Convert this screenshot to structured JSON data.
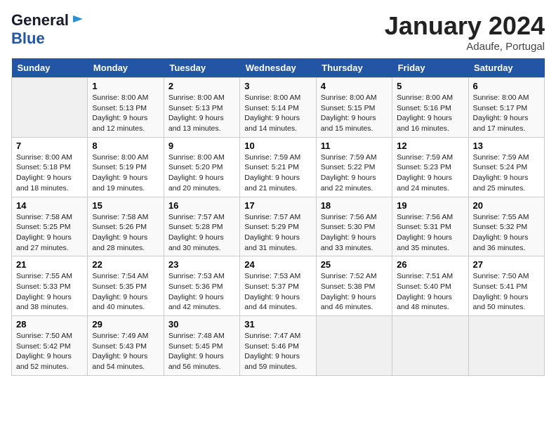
{
  "header": {
    "logo_line1": "General",
    "logo_line2": "Blue",
    "month": "January 2024",
    "location": "Adaufe, Portugal"
  },
  "days_of_week": [
    "Sunday",
    "Monday",
    "Tuesday",
    "Wednesday",
    "Thursday",
    "Friday",
    "Saturday"
  ],
  "weeks": [
    [
      {
        "day": "",
        "sunrise": "",
        "sunset": "",
        "daylight": ""
      },
      {
        "day": "1",
        "sunrise": "8:00 AM",
        "sunset": "5:13 PM",
        "daylight": "9 hours and 12 minutes."
      },
      {
        "day": "2",
        "sunrise": "8:00 AM",
        "sunset": "5:13 PM",
        "daylight": "9 hours and 13 minutes."
      },
      {
        "day": "3",
        "sunrise": "8:00 AM",
        "sunset": "5:14 PM",
        "daylight": "9 hours and 14 minutes."
      },
      {
        "day": "4",
        "sunrise": "8:00 AM",
        "sunset": "5:15 PM",
        "daylight": "9 hours and 15 minutes."
      },
      {
        "day": "5",
        "sunrise": "8:00 AM",
        "sunset": "5:16 PM",
        "daylight": "9 hours and 16 minutes."
      },
      {
        "day": "6",
        "sunrise": "8:00 AM",
        "sunset": "5:17 PM",
        "daylight": "9 hours and 17 minutes."
      }
    ],
    [
      {
        "day": "7",
        "sunrise": "8:00 AM",
        "sunset": "5:18 PM",
        "daylight": "9 hours and 18 minutes."
      },
      {
        "day": "8",
        "sunrise": "8:00 AM",
        "sunset": "5:19 PM",
        "daylight": "9 hours and 19 minutes."
      },
      {
        "day": "9",
        "sunrise": "8:00 AM",
        "sunset": "5:20 PM",
        "daylight": "9 hours and 20 minutes."
      },
      {
        "day": "10",
        "sunrise": "7:59 AM",
        "sunset": "5:21 PM",
        "daylight": "9 hours and 21 minutes."
      },
      {
        "day": "11",
        "sunrise": "7:59 AM",
        "sunset": "5:22 PM",
        "daylight": "9 hours and 22 minutes."
      },
      {
        "day": "12",
        "sunrise": "7:59 AM",
        "sunset": "5:23 PM",
        "daylight": "9 hours and 24 minutes."
      },
      {
        "day": "13",
        "sunrise": "7:59 AM",
        "sunset": "5:24 PM",
        "daylight": "9 hours and 25 minutes."
      }
    ],
    [
      {
        "day": "14",
        "sunrise": "7:58 AM",
        "sunset": "5:25 PM",
        "daylight": "9 hours and 27 minutes."
      },
      {
        "day": "15",
        "sunrise": "7:58 AM",
        "sunset": "5:26 PM",
        "daylight": "9 hours and 28 minutes."
      },
      {
        "day": "16",
        "sunrise": "7:57 AM",
        "sunset": "5:28 PM",
        "daylight": "9 hours and 30 minutes."
      },
      {
        "day": "17",
        "sunrise": "7:57 AM",
        "sunset": "5:29 PM",
        "daylight": "9 hours and 31 minutes."
      },
      {
        "day": "18",
        "sunrise": "7:56 AM",
        "sunset": "5:30 PM",
        "daylight": "9 hours and 33 minutes."
      },
      {
        "day": "19",
        "sunrise": "7:56 AM",
        "sunset": "5:31 PM",
        "daylight": "9 hours and 35 minutes."
      },
      {
        "day": "20",
        "sunrise": "7:55 AM",
        "sunset": "5:32 PM",
        "daylight": "9 hours and 36 minutes."
      }
    ],
    [
      {
        "day": "21",
        "sunrise": "7:55 AM",
        "sunset": "5:33 PM",
        "daylight": "9 hours and 38 minutes."
      },
      {
        "day": "22",
        "sunrise": "7:54 AM",
        "sunset": "5:35 PM",
        "daylight": "9 hours and 40 minutes."
      },
      {
        "day": "23",
        "sunrise": "7:53 AM",
        "sunset": "5:36 PM",
        "daylight": "9 hours and 42 minutes."
      },
      {
        "day": "24",
        "sunrise": "7:53 AM",
        "sunset": "5:37 PM",
        "daylight": "9 hours and 44 minutes."
      },
      {
        "day": "25",
        "sunrise": "7:52 AM",
        "sunset": "5:38 PM",
        "daylight": "9 hours and 46 minutes."
      },
      {
        "day": "26",
        "sunrise": "7:51 AM",
        "sunset": "5:40 PM",
        "daylight": "9 hours and 48 minutes."
      },
      {
        "day": "27",
        "sunrise": "7:50 AM",
        "sunset": "5:41 PM",
        "daylight": "9 hours and 50 minutes."
      }
    ],
    [
      {
        "day": "28",
        "sunrise": "7:50 AM",
        "sunset": "5:42 PM",
        "daylight": "9 hours and 52 minutes."
      },
      {
        "day": "29",
        "sunrise": "7:49 AM",
        "sunset": "5:43 PM",
        "daylight": "9 hours and 54 minutes."
      },
      {
        "day": "30",
        "sunrise": "7:48 AM",
        "sunset": "5:45 PM",
        "daylight": "9 hours and 56 minutes."
      },
      {
        "day": "31",
        "sunrise": "7:47 AM",
        "sunset": "5:46 PM",
        "daylight": "9 hours and 59 minutes."
      },
      {
        "day": "",
        "sunrise": "",
        "sunset": "",
        "daylight": ""
      },
      {
        "day": "",
        "sunrise": "",
        "sunset": "",
        "daylight": ""
      },
      {
        "day": "",
        "sunrise": "",
        "sunset": "",
        "daylight": ""
      }
    ]
  ]
}
